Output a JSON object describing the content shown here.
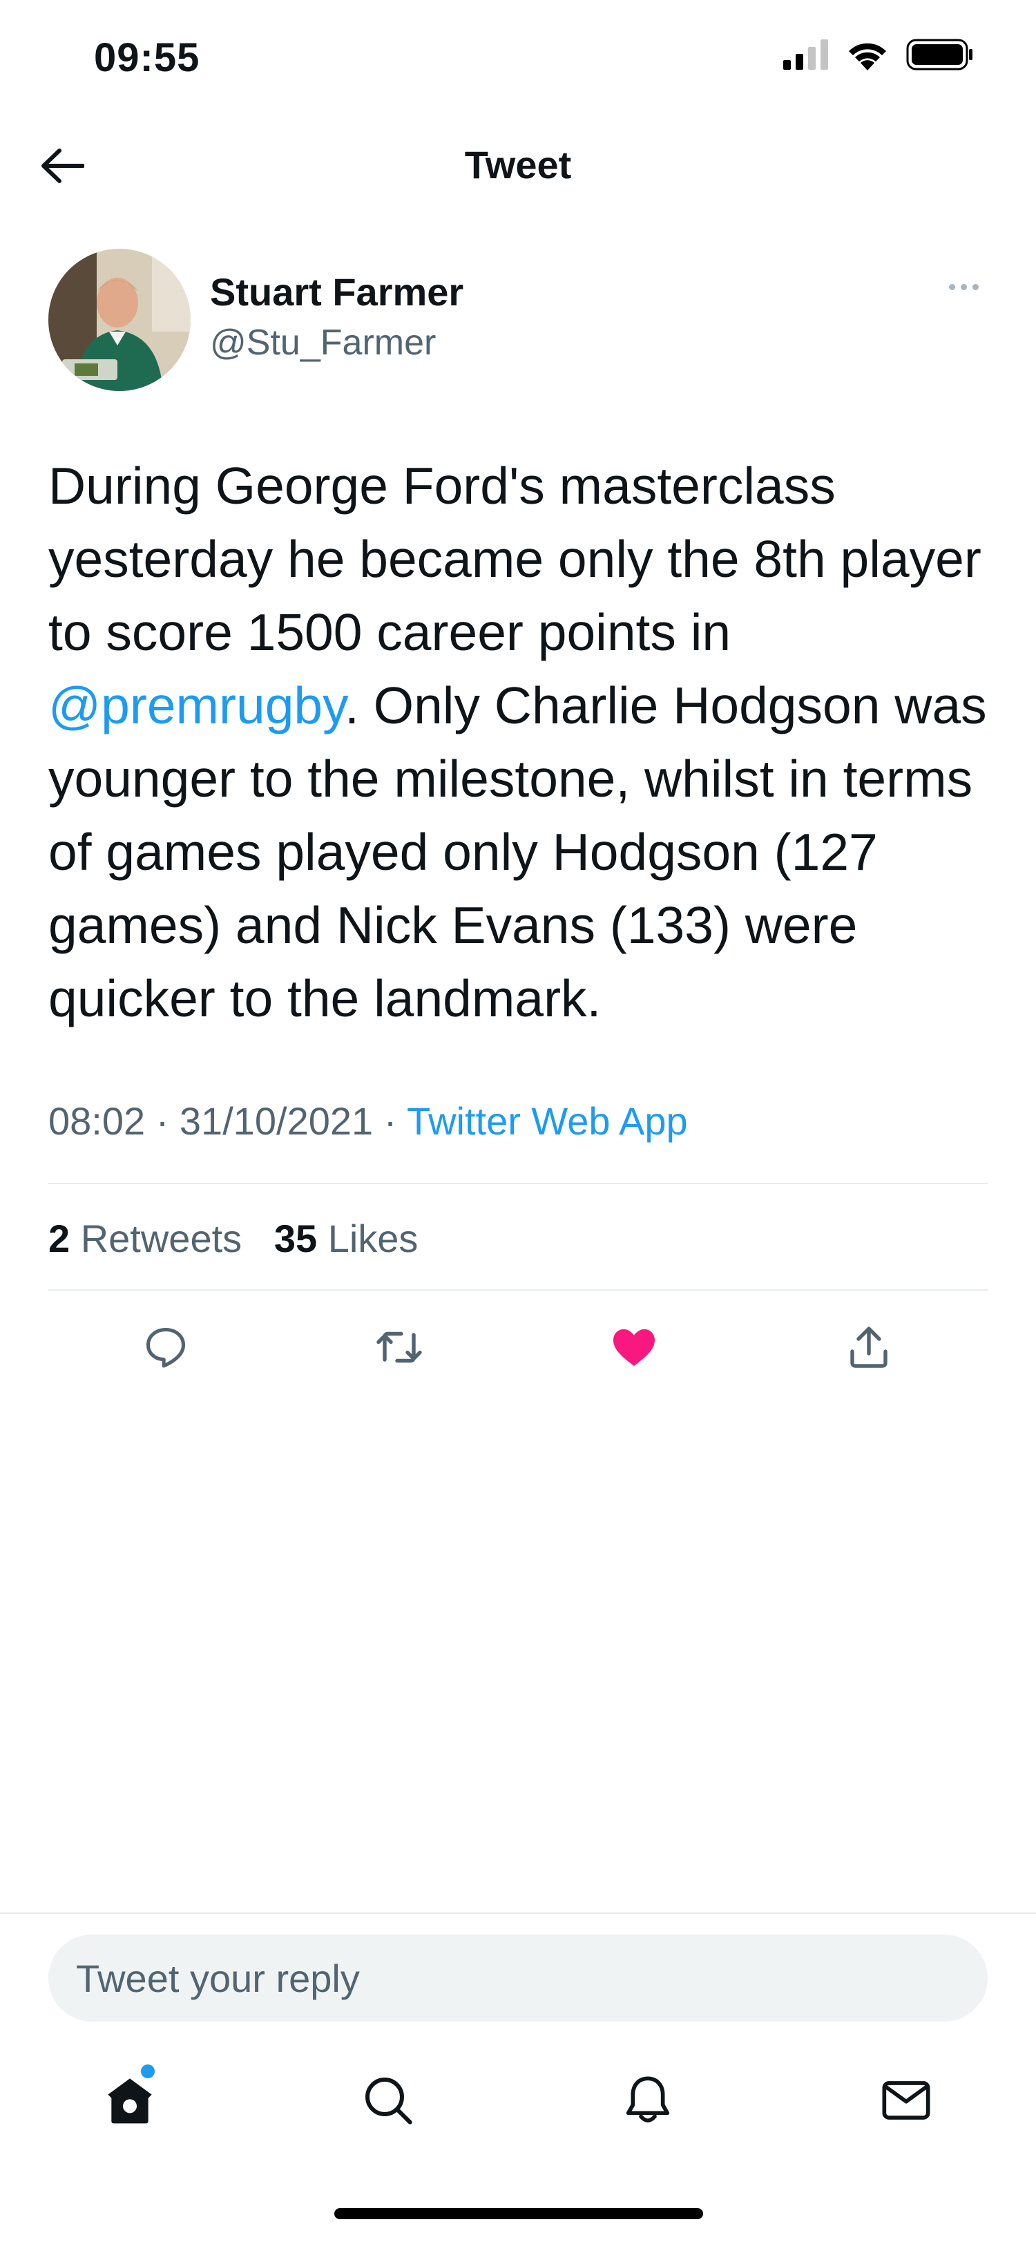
{
  "status_bar": {
    "time": "09:55"
  },
  "header": {
    "title": "Tweet"
  },
  "author": {
    "name": "Stuart Farmer",
    "handle": "@Stu_Farmer"
  },
  "tweet": {
    "text_before": "During George Ford's masterclass yesterday he became only the 8th player to score 1500 career points in ",
    "mention": "@premrugby",
    "text_after": ". Only Charlie Hodgson was younger to the milestone, whilst in terms of games played only Hodgson (127 games) and Nick Evans (133) were quicker to the landmark."
  },
  "meta": {
    "time": "08:02",
    "separator": " · ",
    "date": "31/10/2021",
    "source": "Twitter Web App"
  },
  "counts": {
    "retweets": "2",
    "retweets_label": "Retweets",
    "likes": "35",
    "likes_label": "Likes"
  },
  "actions": {
    "liked": true,
    "like_color": "#f91880"
  },
  "reply": {
    "placeholder": "Tweet your reply"
  },
  "colors": {
    "accent": "#1d9bf0",
    "secondary_text": "#536471"
  },
  "nav": {
    "icons": [
      "home-icon",
      "search-icon",
      "bell-icon",
      "mail-icon"
    ],
    "home_has_notification": true
  }
}
